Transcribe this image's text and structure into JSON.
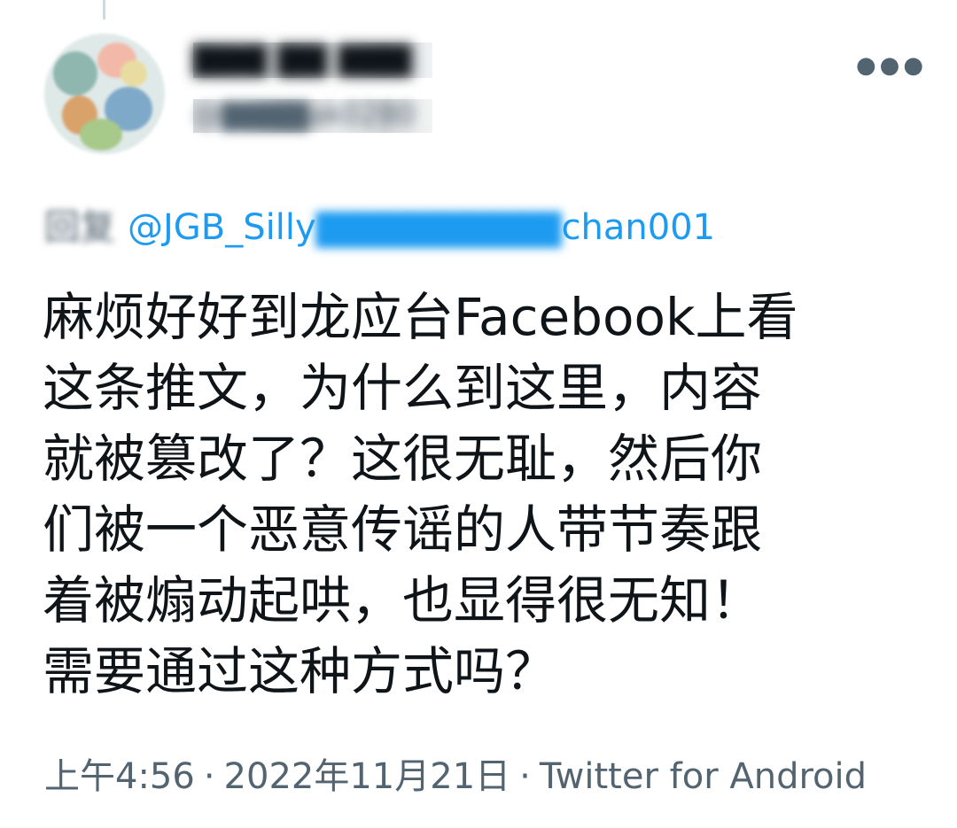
{
  "tweet": {
    "author": {
      "display_name": "▇▇▇ ▇▇ ▇▇▇",
      "handle": "@▇▇▇▇ak0280"
    },
    "more_icon": "more-horizontal-icon",
    "reply_to": {
      "prefix": "回复",
      "handle_visible": "@JGB_Silly",
      "handle_blurred": "▇▇▇▇▇▇▇▇▇",
      "handle_suffix": "chan001"
    },
    "text_lines": [
      "麻烦好好到龙应台Facebook上看",
      "这条推文，为什么到这里，内容",
      "就被篡改了？这很无耻，然后你",
      "们被一个恶意传谣的人带节奏跟",
      "着被煽动起哄，也显得很无知！",
      "需要通过这种方式吗？"
    ],
    "meta": {
      "time": "上午4:56",
      "separator": "·",
      "date": "2022年11月21日",
      "source": "Twitter for Android"
    }
  }
}
